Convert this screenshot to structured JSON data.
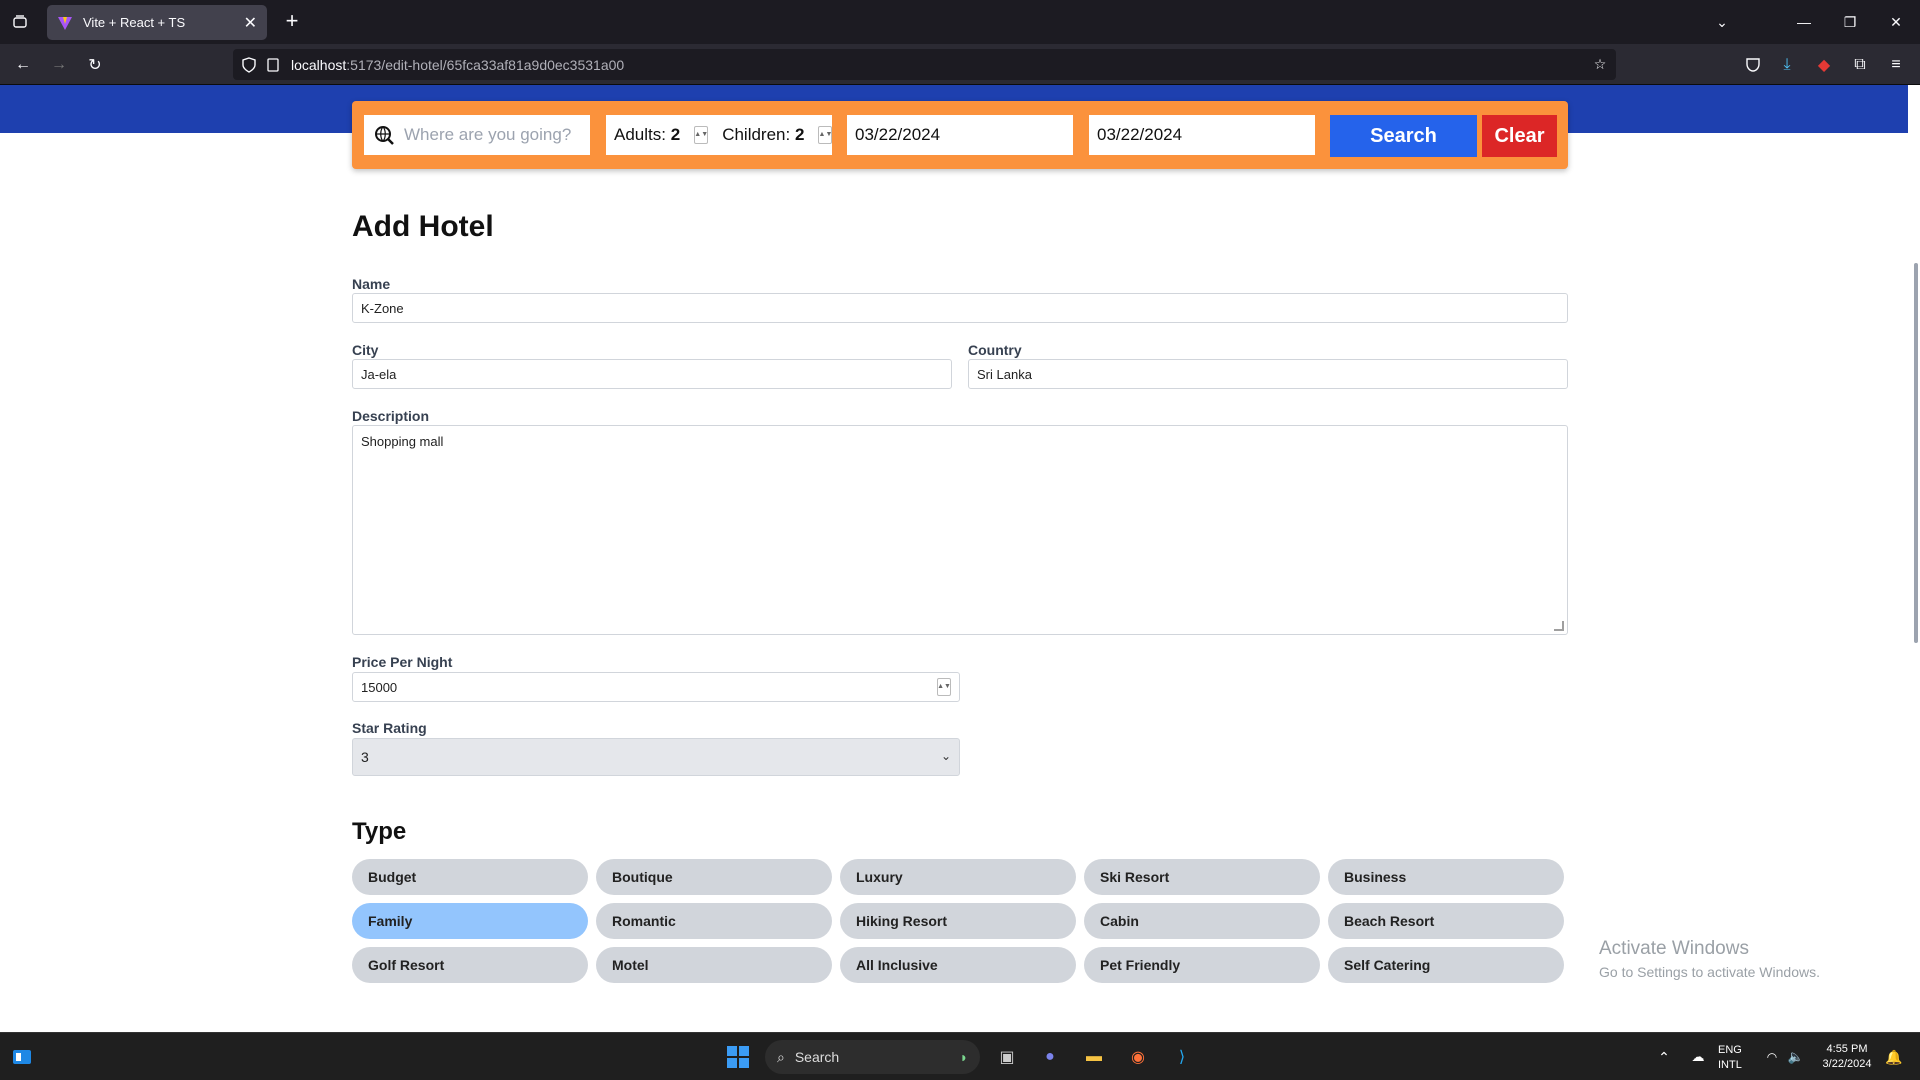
{
  "browser": {
    "tab_title": "Vite + React + TS",
    "url_host": "localhost",
    "url_path": ":5173/edit-hotel/65fca33af81a9d0ec3531a00"
  },
  "search": {
    "destination_placeholder": "Where are you going?",
    "adults_label": "Adults:",
    "adults_value": "2",
    "children_label": "Children:",
    "children_value": "2",
    "check_in": "03/22/2024",
    "check_out": "03/22/2024",
    "search_label": "Search",
    "clear_label": "Clear"
  },
  "form": {
    "title": "Add Hotel",
    "name_label": "Name",
    "name_value": "K-Zone",
    "city_label": "City",
    "city_value": "Ja-ela",
    "country_label": "Country",
    "country_value": "Sri Lanka",
    "description_label": "Description",
    "description_value": "Shopping mall",
    "price_label": "Price Per Night",
    "price_value": "15000",
    "star_label": "Star Rating",
    "star_value": "3"
  },
  "types": {
    "title": "Type",
    "items": [
      {
        "label": "Budget",
        "selected": false
      },
      {
        "label": "Boutique",
        "selected": false
      },
      {
        "label": "Luxury",
        "selected": false
      },
      {
        "label": "Ski Resort",
        "selected": false
      },
      {
        "label": "Business",
        "selected": false
      },
      {
        "label": "Family",
        "selected": true
      },
      {
        "label": "Romantic",
        "selected": false
      },
      {
        "label": "Hiking Resort",
        "selected": false
      },
      {
        "label": "Cabin",
        "selected": false
      },
      {
        "label": "Beach Resort",
        "selected": false
      },
      {
        "label": "Golf Resort",
        "selected": false
      },
      {
        "label": "Motel",
        "selected": false
      },
      {
        "label": "All Inclusive",
        "selected": false
      },
      {
        "label": "Pet Friendly",
        "selected": false
      },
      {
        "label": "Self Catering",
        "selected": false
      }
    ]
  },
  "watermark": {
    "line1": "Activate Windows",
    "line2": "Go to Settings to activate Windows."
  },
  "taskbar": {
    "search_label": "Search",
    "lang_line1": "ENG",
    "lang_line2": "INTL",
    "time": "4:55 PM",
    "date": "3/22/2024"
  },
  "colors": {
    "header_blue": "#1e40af",
    "searchbar_orange": "#fb923c",
    "search_button": "#2563eb",
    "clear_button": "#dc2626",
    "selected_type": "#93c5fd"
  }
}
